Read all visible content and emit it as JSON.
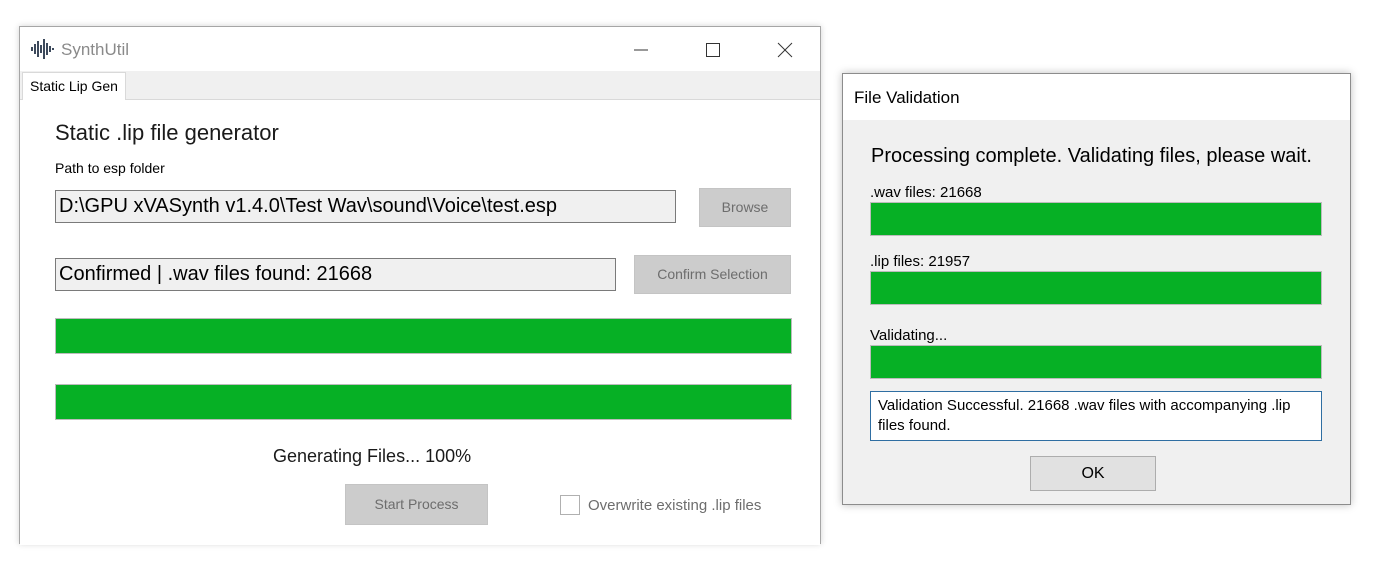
{
  "main_window": {
    "title": "SynthUtil",
    "tabs": [
      {
        "label": "Static Lip Gen",
        "active": true
      }
    ],
    "heading": "Static .lip file generator",
    "path_label": "Path to esp folder",
    "path_value": "D:\\GPU xVASynth v1.4.0\\Test Wav\\sound\\Voice\\test.esp",
    "browse_label": "Browse",
    "confirm_value": "Confirmed | .wav files found: 21668",
    "confirm_label": "Confirm Selection",
    "progress_bars": [
      {
        "value": 1.0
      },
      {
        "value": 1.0
      }
    ],
    "status_text": "Generating Files... 100%",
    "start_label": "Start Process",
    "overwrite_label": "Overwrite existing .lip files",
    "overwrite_checked": false
  },
  "dialog": {
    "title": "File Validation",
    "heading": "Processing complete. Validating files, please wait.",
    "wav_label": ".wav files: 21668",
    "lip_label": ".lip files: 21957",
    "validating_label": "Validating...",
    "progress_bars": [
      {
        "value": 1.0
      },
      {
        "value": 1.0
      },
      {
        "value": 1.0
      }
    ],
    "message": "Validation Successful. 21668 .wav files with accompanying .lip files found.",
    "ok_label": "OK"
  },
  "colors": {
    "progress_fill": "#06b025",
    "disabled_button": "#cccccc",
    "message_border": "#2f6ea2"
  },
  "icons": {
    "app": "waveform-icon",
    "minimize": "minimize-icon",
    "maximize": "maximize-icon",
    "close": "close-icon"
  }
}
